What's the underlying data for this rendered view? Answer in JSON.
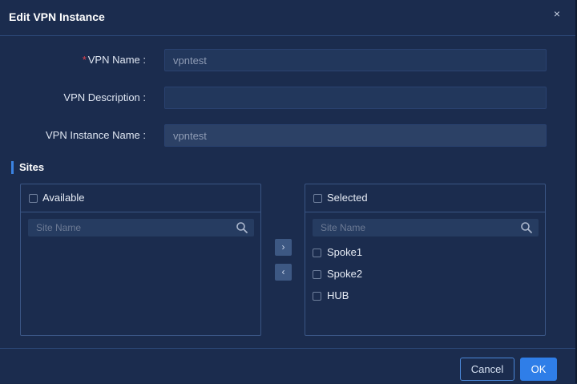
{
  "dialog": {
    "title": "Edit VPN Instance",
    "close_glyph": "×"
  },
  "form": {
    "vpn_name": {
      "required_mark": "*",
      "label": "VPN Name :",
      "value": "vpntest"
    },
    "vpn_description": {
      "label": "VPN Description :",
      "value": ""
    },
    "vpn_instance_name": {
      "label": "VPN Instance Name :",
      "value": "vpntest",
      "disabled": true
    }
  },
  "sites": {
    "section_title": "Sites",
    "available": {
      "header": "Available",
      "search_placeholder": "Site Name",
      "items": []
    },
    "selected": {
      "header": "Selected",
      "search_placeholder": "Site Name",
      "items": [
        {
          "label": "Spoke1",
          "checked": false
        },
        {
          "label": "Spoke2",
          "checked": false
        },
        {
          "label": "HUB",
          "checked": false
        }
      ]
    },
    "move_right_glyph": "›",
    "move_left_glyph": "‹"
  },
  "footer": {
    "cancel_label": "Cancel",
    "ok_label": "OK"
  },
  "colors": {
    "accent": "#2f7ee8",
    "background": "#1b2c4e",
    "required": "#e0424c"
  }
}
